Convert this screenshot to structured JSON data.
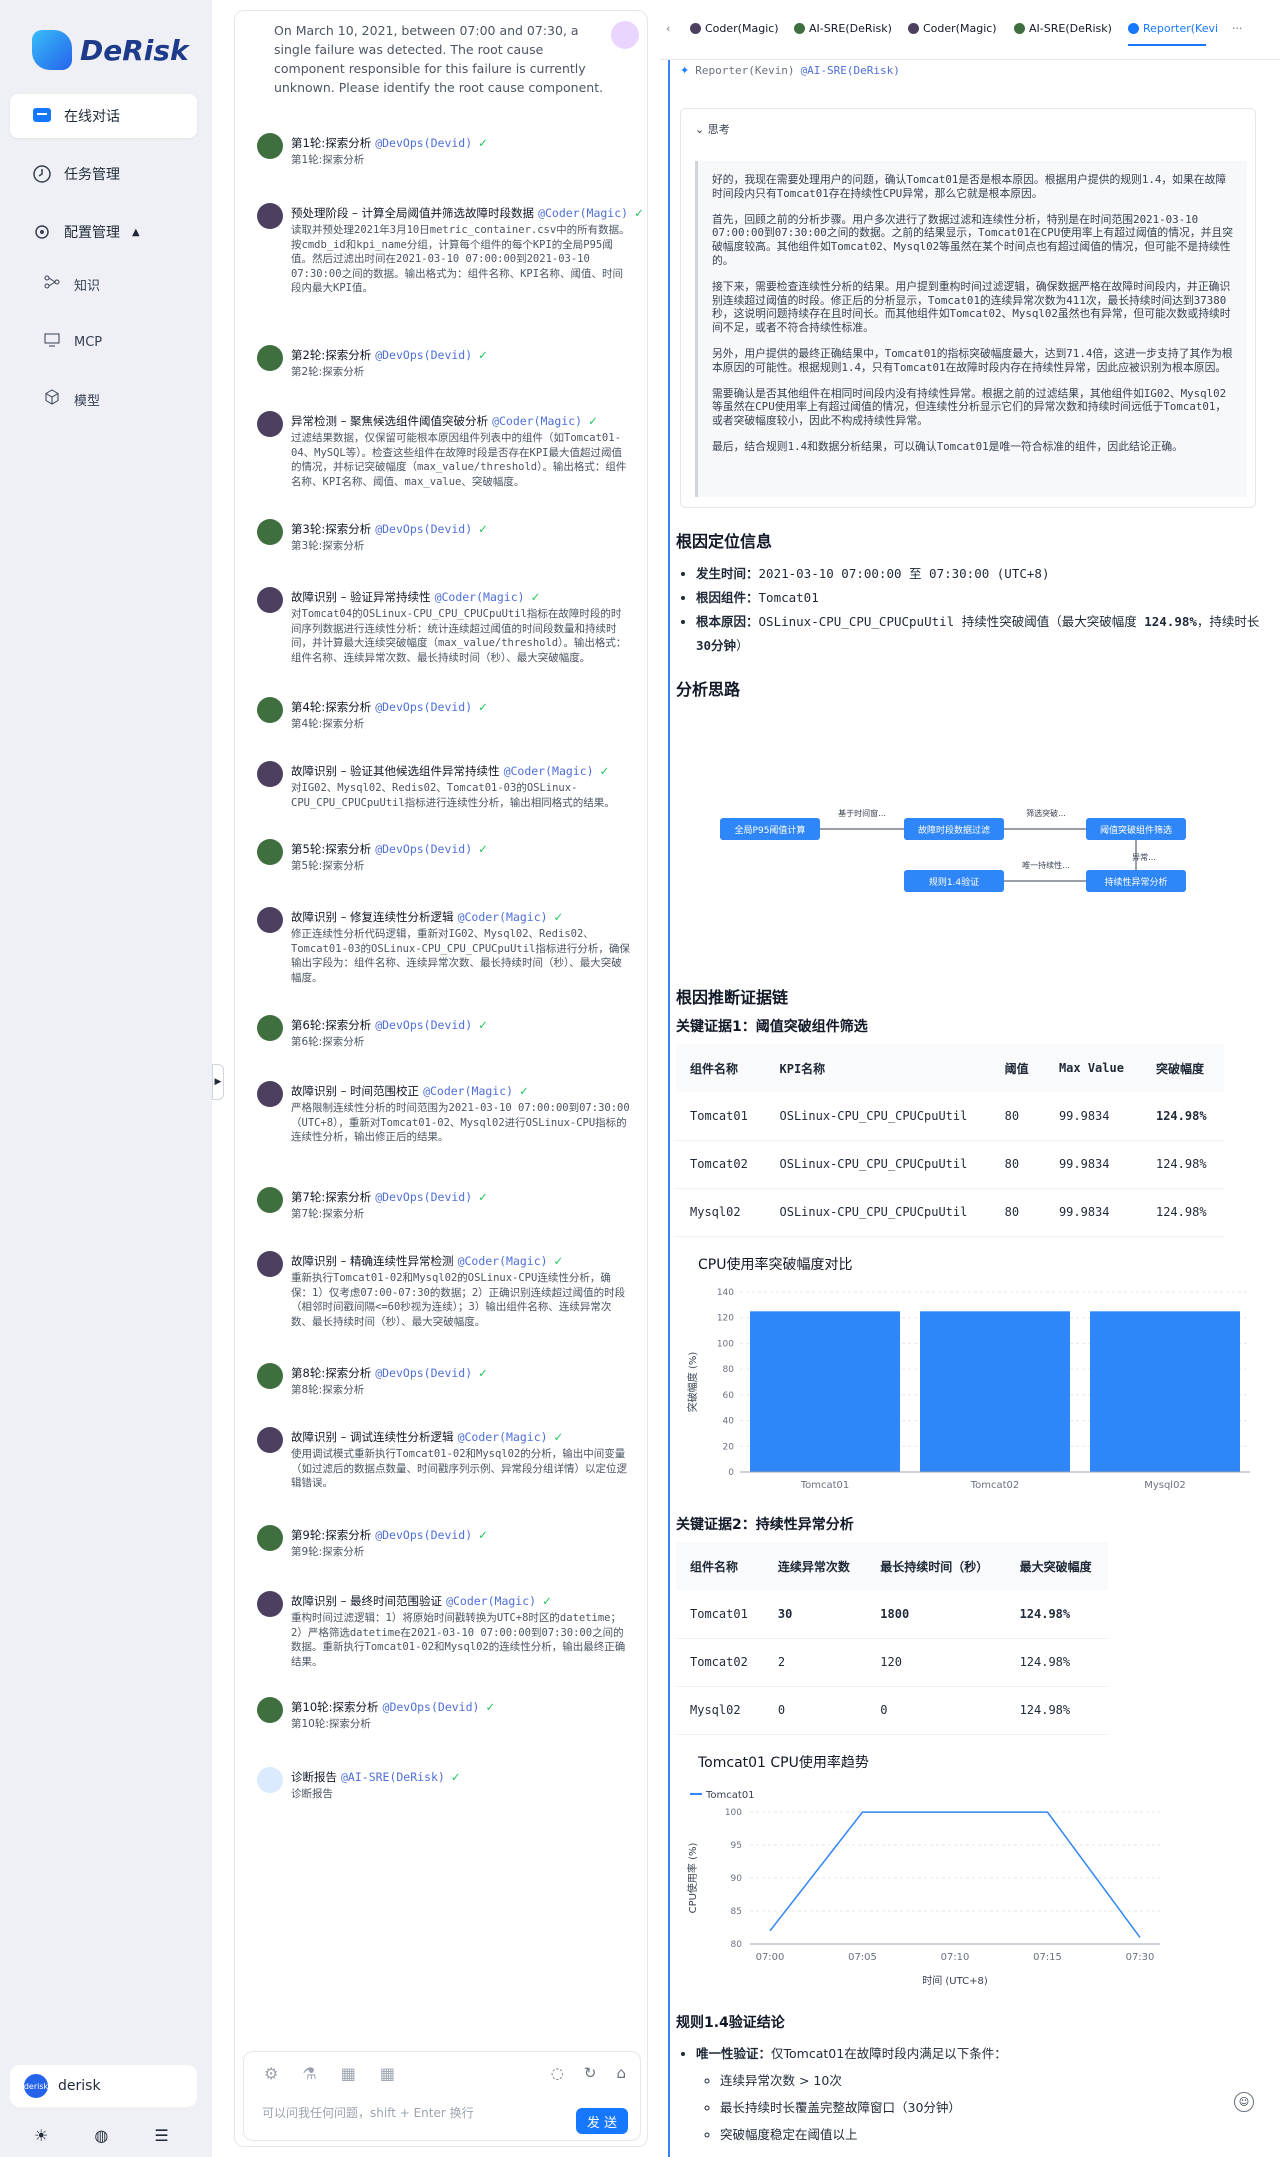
{
  "brand": {
    "name": "DeRisk"
  },
  "sidebar": {
    "nav": [
      {
        "label": "在线对话",
        "icon": "chat-icon"
      },
      {
        "label": "任务管理",
        "icon": "clock-icon"
      },
      {
        "label": "配置管理",
        "icon": "gear-icon"
      }
    ],
    "sub": [
      {
        "label": "知识",
        "icon": "knowledge-icon"
      },
      {
        "label": "MCP",
        "icon": "monitor-icon"
      },
      {
        "label": "模型",
        "icon": "cube-icon"
      }
    ],
    "user": {
      "name": "derisk",
      "avatar_text": "derisk"
    }
  },
  "chat": {
    "question": "On March 10, 2021, between 07:00 and 07:30, a single failure was detected. The root cause component responsible for this failure is currently unknown. Please identify the root cause component.",
    "steps": [
      {
        "title": "第1轮:探索分析",
        "agent": "@DevOps(Devid)",
        "desc": "第1轮:探索分析",
        "kind": "dev"
      },
      {
        "title": "预处理阶段 – 计算全局阈值并筛选故障时段数据",
        "agent": "@Coder(Magic)",
        "desc": "读取并预处理2021年3月10日metric_container.csv中的所有数据。按cmdb_id和kpi_name分组，计算每个组件的每个KPI的全局P95阈值。然后过滤出时间在2021-03-10 07:00:00到2021-03-10 07:30:00之间的数据。输出格式为：组件名称、KPI名称、阈值、时间段内最大KPI值。",
        "kind": "cod"
      },
      {
        "title": "第2轮:探索分析",
        "agent": "@DevOps(Devid)",
        "desc": "第2轮:探索分析",
        "kind": "dev"
      },
      {
        "title": "异常检测 – 聚焦候选组件阈值突破分析",
        "agent": "@Coder(Magic)",
        "desc": "过滤结果数据，仅保留可能根本原因组件列表中的组件（如Tomcat01-04、MySQL等）。检查这些组件在故障时段是否存在KPI最大值超过阈值的情况，并标记突破幅度（max_value/threshold）。输出格式：组件名称、KPI名称、阈值、max_value、突破幅度。",
        "kind": "cod"
      },
      {
        "title": "第3轮:探索分析",
        "agent": "@DevOps(Devid)",
        "desc": "第3轮:探索分析",
        "kind": "dev"
      },
      {
        "title": "故障识别 – 验证异常持续性",
        "agent": "@Coder(Magic)",
        "desc": "对Tomcat04的OSLinux-CPU_CPU_CPUCpuUtil指标在故障时段的时间序列数据进行连续性分析：统计连续超过阈值的时间段数量和持续时间，并计算最大连续突破幅度（max_value/threshold）。输出格式：组件名称、连续异常次数、最长持续时间（秒）、最大突破幅度。",
        "kind": "cod"
      },
      {
        "title": "第4轮:探索分析",
        "agent": "@DevOps(Devid)",
        "desc": "第4轮:探索分析",
        "kind": "dev"
      },
      {
        "title": "故障识别 – 验证其他候选组件异常持续性",
        "agent": "@Coder(Magic)",
        "desc": "对IG02、Mysql02、Redis02、Tomcat01-03的OSLinux-CPU_CPU_CPUCpuUtil指标进行连续性分析，输出相同格式的结果。",
        "kind": "cod"
      },
      {
        "title": "第5轮:探索分析",
        "agent": "@DevOps(Devid)",
        "desc": "第5轮:探索分析",
        "kind": "dev"
      },
      {
        "title": "故障识别 – 修复连续性分析逻辑",
        "agent": "@Coder(Magic)",
        "desc": "修正连续性分析代码逻辑，重新对IG02、Mysql02、Redis02、Tomcat01-03的OSLinux-CPU_CPU_CPUCpuUtil指标进行分析，确保输出字段为：组件名称、连续异常次数、最长持续时间（秒）、最大突破幅度。",
        "kind": "cod"
      },
      {
        "title": "第6轮:探索分析",
        "agent": "@DevOps(Devid)",
        "desc": "第6轮:探索分析",
        "kind": "dev"
      },
      {
        "title": "故障识别 – 时间范围校正",
        "agent": "@Coder(Magic)",
        "desc": "严格限制连续性分析的时间范围为2021-03-10 07:00:00到07:30:00（UTC+8），重新对Tomcat01-02、Mysql02进行OSLinux-CPU指标的连续性分析，输出修正后的结果。",
        "kind": "cod"
      },
      {
        "title": "第7轮:探索分析",
        "agent": "@DevOps(Devid)",
        "desc": "第7轮:探索分析",
        "kind": "dev"
      },
      {
        "title": "故障识别 – 精确连续性异常检测",
        "agent": "@Coder(Magic)",
        "desc": "重新执行Tomcat01-02和Mysql02的OSLinux-CPU连续性分析，确保：1）仅考虑07:00-07:30的数据；2）正确识别连续超过阈值的时段（相邻时间戳间隔<=60秒视为连续）；3）输出组件名称、连续异常次数、最长持续时间（秒）、最大突破幅度。",
        "kind": "cod"
      },
      {
        "title": "第8轮:探索分析",
        "agent": "@DevOps(Devid)",
        "desc": "第8轮:探索分析",
        "kind": "dev"
      },
      {
        "title": "故障识别 – 调试连续性分析逻辑",
        "agent": "@Coder(Magic)",
        "desc": "使用调试模式重新执行Tomcat01-02和Mysql02的分析，输出中间变量（如过滤后的数据点数量、时间戳序列示例、异常段分组详情）以定位逻辑错误。",
        "kind": "cod"
      },
      {
        "title": "第9轮:探索分析",
        "agent": "@DevOps(Devid)",
        "desc": "第9轮:探索分析",
        "kind": "dev"
      },
      {
        "title": "故障识别 – 最终时间范围验证",
        "agent": "@Coder(Magic)",
        "desc": "重构时间过滤逻辑：1）将原始时间戳转换为UTC+8时区的datetime；2）严格筛选datetime在2021-03-10 07:00:00到07:30:00之间的数据。重新执行Tomcat01-02和Mysql02的连续性分析，输出最终正确结果。",
        "kind": "cod"
      },
      {
        "title": "第10轮:探索分析",
        "agent": "@DevOps(Devid)",
        "desc": "第10轮:探索分析",
        "kind": "dev"
      },
      {
        "title": "诊断报告",
        "agent": "@AI-SRE(DeRisk)",
        "desc": "诊断报告",
        "kind": "sre"
      }
    ],
    "input": {
      "placeholder": "可以问我任何问题，shift + Enter 换行",
      "send_label": "发 送"
    }
  },
  "report": {
    "tabs": [
      {
        "label": "Coder(Magic)",
        "kind": "cod"
      },
      {
        "label": "AI-SRE(DeRisk)",
        "kind": "dev"
      },
      {
        "label": "Coder(Magic)",
        "kind": "cod"
      },
      {
        "label": "AI-SRE(DeRisk)",
        "kind": "dev"
      },
      {
        "label": "Reporter(Kevi",
        "kind": "rep"
      }
    ],
    "tab_left": "‹",
    "tabs_more": "···",
    "header_name": "Reporter(Kevin)",
    "header_agent": "@AI-SRE(DeRisk)",
    "think_title": "思考",
    "think_paragraphs": [
      "好的，我现在需要处理用户的问题，确认Tomcat01是否是根本原因。根据用户提供的规则1.4，如果在故障时间段内只有Tomcat01存在持续性CPU异常，那么它就是根本原因。",
      "首先，回顾之前的分析步骤。用户多次进行了数据过滤和连续性分析，特别是在时间范围2021-03-10 07:00:00到07:30:00之间的数据。之前的结果显示，Tomcat01在CPU使用率上有超过阈值的情况，并且突破幅度较高。其他组件如Tomcat02、Mysql02等虽然在某个时间点也有超过阈值的情况，但可能不是持续性的。",
      "接下来，需要检查连续性分析的结果。用户提到重构时间过滤逻辑，确保数据严格在故障时间段内，并正确识别连续超过阈值的时段。修正后的分析显示，Tomcat01的连续异常次数为411次，最长持续时间达到37380秒，这说明问题持续存在且时间长。而其他组件如Tomcat02、Mysql02虽然也有异常，但可能次数或持续时间不足，或者不符合持续性标准。",
      "另外，用户提供的最终正确结果中，Tomcat01的指标突破幅度最大，达到71.4倍，这进一步支持了其作为根本原因的可能性。根据规则1.4，只有Tomcat01在故障时段内存在持续性异常，因此应被识别为根本原因。",
      "需要确认是否其他组件在相同时间段内没有持续性异常。根据之前的过滤结果，其他组件如IG02、Mysql02等虽然在CPU使用率上有超过阈值的情况，但连续性分析显示它们的异常次数和持续时间远低于Tomcat01，或者突破幅度较小，因此不构成持续性异常。",
      "最后，结合规则1.4和数据分析结果，可以确认Tomcat01是唯一符合标准的组件，因此结论正确。"
    ],
    "rc_title": "根因定位信息",
    "rc_items": [
      {
        "label": "发生时间：",
        "value": "2021-03-10 07:00:00 至 07:30:00 (UTC+8)"
      },
      {
        "label": "根因组件：",
        "value": "Tomcat01"
      },
      {
        "label": "根本原因：",
        "value": "OSLinux-CPU_CPU_CPUCpuUtil 持续性突破阈值（最大突破幅度 ",
        "value_bold": "124.98%",
        "value_mid": "，持续时长 ",
        "value_bold2": "30分钟",
        "value_end": "）"
      }
    ],
    "flow_title": "分析思路",
    "flow": {
      "nodes": [
        "全局P95阈值计算",
        "故障时段数据过滤",
        "阈值突破组件筛选",
        "持续性异常分析",
        "规则1.4验证"
      ],
      "edges": [
        "基于时间窗...",
        "筛选突破...",
        "异常...",
        "唯一持续性..."
      ]
    },
    "evidence_title": "根因推断证据链",
    "ev1_title": "关键证据1：阈值突破组件筛选",
    "table1": {
      "headers": [
        "组件名称",
        "KPI名称",
        "阈值",
        "Max Value",
        "突破幅度"
      ],
      "rows": [
        [
          "Tomcat01",
          "OSLinux-CPU_CPU_CPUCpuUtil",
          "80",
          "99.9834",
          "124.98%"
        ],
        [
          "Tomcat02",
          "OSLinux-CPU_CPU_CPUCpuUtil",
          "80",
          "99.9834",
          "124.98%"
        ],
        [
          "Mysql02",
          "OSLinux-CPU_CPU_CPUCpuUtil",
          "80",
          "99.9834",
          "124.98%"
        ]
      ]
    },
    "ev2_title": "关键证据2：持续性异常分析",
    "table2": {
      "headers": [
        "组件名称",
        "连续异常次数",
        "最长持续时间（秒）",
        "最大突破幅度"
      ],
      "rows": [
        [
          "Tomcat01",
          "30",
          "1800",
          "124.98%"
        ],
        [
          "Tomcat02",
          "2",
          "120",
          "124.98%"
        ],
        [
          "Mysql02",
          "0",
          "0",
          "124.98%"
        ]
      ]
    },
    "rule_title": "规则1.4验证结论",
    "rule_lead_label": "唯一性验证：",
    "rule_lead_value": "仅Tomcat01在故障时段内满足以下条件：",
    "rule_items": [
      "连续异常次数 > 10次",
      "最长持续时长覆盖完整故障窗口（30分钟）",
      "突破幅度稳定在阈值以上"
    ]
  },
  "chart_data": [
    {
      "type": "bar",
      "title": "CPU使用率突破幅度对比",
      "categories": [
        "Tomcat01",
        "Tomcat02",
        "Mysql02"
      ],
      "values": [
        124.98,
        124.98,
        124.98
      ],
      "ylabel": "突破幅度 (%)",
      "ylim": [
        0,
        140
      ],
      "yticks": [
        0,
        20,
        40,
        60,
        80,
        100,
        120,
        140
      ],
      "color": "#2f86f6",
      "grid": true
    },
    {
      "type": "line",
      "title": "Tomcat01 CPU使用率趋势",
      "series": [
        {
          "name": "Tomcat01",
          "x": [
            "07:00",
            "07:05",
            "07:10",
            "07:15",
            "07:30"
          ],
          "values": [
            82,
            99.98,
            99.98,
            99.98,
            81
          ]
        }
      ],
      "x_ticks": [
        "07:00",
        "07:05",
        "07:10",
        "07:15",
        "07:30"
      ],
      "xlabel": "时间 (UTC+8)",
      "ylabel": "CPU使用率 (%)",
      "ylim": [
        80,
        100
      ],
      "yticks": [
        80,
        85,
        90,
        95,
        100
      ],
      "legend": "top-left",
      "color": "#2f86f6"
    }
  ],
  "colors": {
    "accent": "#1677ff",
    "link": "#4f6fd8",
    "success": "#22c55e"
  }
}
